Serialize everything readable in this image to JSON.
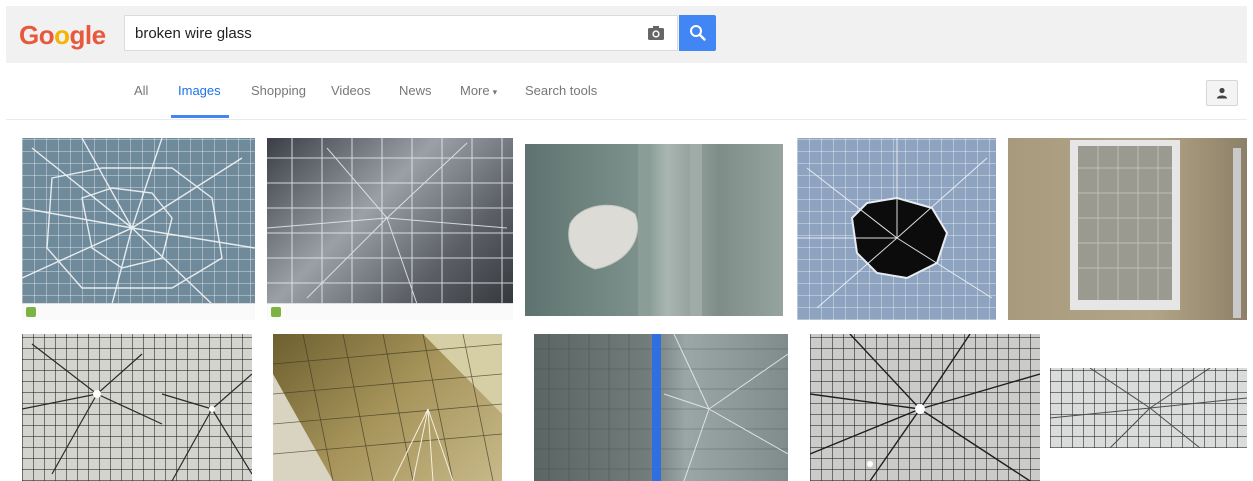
{
  "logo": {
    "letters": [
      "G",
      "o",
      "o",
      "g",
      "l",
      "e"
    ],
    "colors": [
      "#e8583c",
      "#e8583c",
      "#f4b400",
      "#e8583c",
      "#e8583c",
      "#e8583c"
    ]
  },
  "search": {
    "query": "broken wire glass",
    "camera_icon": "camera-icon",
    "button_icon": "magnifier-icon",
    "accent": "#4285f4"
  },
  "nav": {
    "tabs": [
      {
        "label": "All",
        "active": false
      },
      {
        "label": "Images",
        "active": true
      },
      {
        "label": "Shopping",
        "active": false
      },
      {
        "label": "Videos",
        "active": false
      },
      {
        "label": "News",
        "active": false
      },
      {
        "label": "More",
        "active": false
      },
      {
        "label": "Search tools",
        "active": false
      }
    ],
    "more_caret": "▾",
    "account_icon": "person-icon"
  },
  "results": {
    "row1": [
      {
        "subject": "cracked wired glass pane",
        "tone": "#6f8a9a"
      },
      {
        "subject": "shattered wired glass, dark background",
        "tone": "#7a7f85"
      },
      {
        "subject": "wired glass panel with hole",
        "tone": "#7d928c"
      },
      {
        "subject": "wired glass with punched hole, blue",
        "tone": "#8ea3c0"
      },
      {
        "subject": "door window with broken wired glass",
        "tone": "#9c8f77"
      }
    ],
    "row2": [
      {
        "subject": "wired glass with impact cracks",
        "tone": "#c8c8c2"
      },
      {
        "subject": "wired glass corner break, golden",
        "tone": "#8a7a45"
      },
      {
        "subject": "wired glass with blue tape strip",
        "tone": "#7f8f8f"
      },
      {
        "subject": "wired glass with radial cracks",
        "tone": "#c9cac8"
      },
      {
        "subject": "close-up cracked wired glass",
        "tone": "#d8dadb"
      }
    ]
  }
}
